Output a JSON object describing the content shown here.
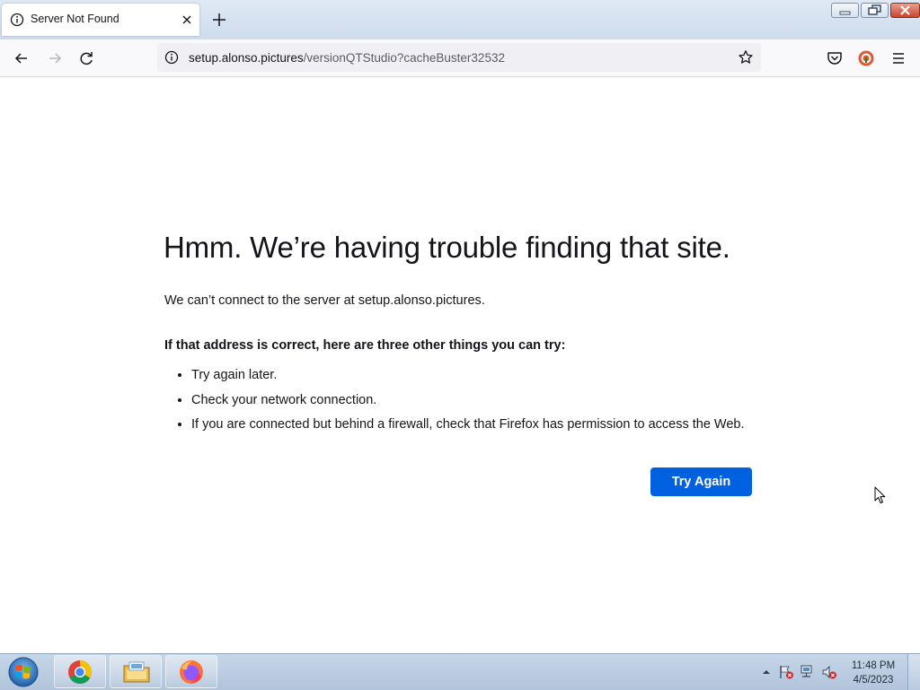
{
  "tab": {
    "title": "Server Not Found"
  },
  "url": {
    "host": "setup.alonso.pictures",
    "path": "/versionQTStudio?cacheBuster32532"
  },
  "error": {
    "title": "Hmm. We’re having trouble finding that site.",
    "description": "We can’t connect to the server at setup.alonso.pictures.",
    "subheading": "If that address is correct, here are three other things you can try:",
    "suggestions": [
      "Try again later.",
      "Check your network connection.",
      "If you are connected but behind a firewall, check that Firefox has permission to access the Web."
    ],
    "button_label": "Try Again"
  },
  "taskbar": {
    "items": [
      "chrome-icon",
      "file-explorer-icon",
      "firefox-icon"
    ],
    "time": "11:48 PM",
    "date": "4/5/2023"
  },
  "colors": {
    "accent": "#0061e0",
    "text": "#15141a",
    "url_muted": "#5b5b66"
  }
}
